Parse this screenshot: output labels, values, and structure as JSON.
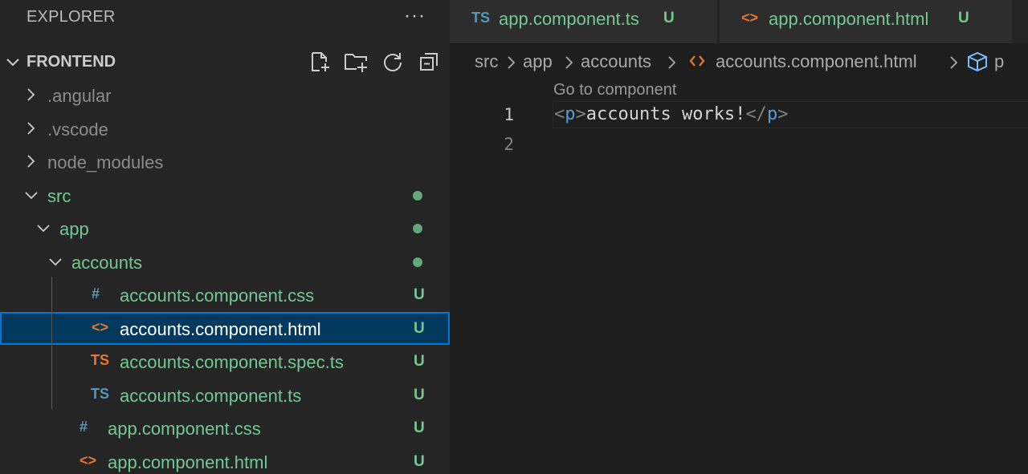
{
  "explorer": {
    "title": "EXPLORER",
    "more_label": "···",
    "section_title": "FRONTEND",
    "actions": [
      "new-file",
      "new-folder",
      "refresh",
      "collapse-all"
    ]
  },
  "tree": [
    {
      "label": ".angular",
      "type": "folder",
      "state": "collapsed",
      "depth": 0,
      "color": "dim"
    },
    {
      "label": ".vscode",
      "type": "folder",
      "state": "collapsed",
      "depth": 0,
      "color": "dim"
    },
    {
      "label": "node_modules",
      "type": "folder",
      "state": "collapsed",
      "depth": 0,
      "color": "dim"
    },
    {
      "label": "src",
      "type": "folder",
      "state": "expanded",
      "depth": 0,
      "color": "green",
      "decoration": "dot"
    },
    {
      "label": "app",
      "type": "folder",
      "state": "expanded",
      "depth": 1,
      "color": "green",
      "decoration": "dot"
    },
    {
      "label": "accounts",
      "type": "folder",
      "state": "expanded",
      "depth": 2,
      "color": "green",
      "decoration": "dot"
    },
    {
      "label": "accounts.component.css",
      "type": "file",
      "icon": "#",
      "icon_name": "css-icon",
      "icon_color": "#519aba",
      "depth": 3,
      "color": "green",
      "badge": "U"
    },
    {
      "label": "accounts.component.html",
      "type": "file",
      "icon": "<>",
      "icon_name": "html-icon",
      "icon_color": "#e37933",
      "depth": 3,
      "color": "white",
      "badge": "U",
      "selected": true
    },
    {
      "label": "accounts.component.spec.ts",
      "type": "file",
      "icon": "TS",
      "icon_name": "ts-spec-icon",
      "icon_color": "#e37933",
      "depth": 3,
      "color": "green",
      "badge": "U"
    },
    {
      "label": "accounts.component.ts",
      "type": "file",
      "icon": "TS",
      "icon_name": "ts-icon",
      "icon_color": "#519aba",
      "depth": 3,
      "color": "green",
      "badge": "U"
    },
    {
      "label": "app.component.css",
      "type": "file",
      "icon": "#",
      "icon_name": "css-icon",
      "icon_color": "#519aba",
      "depth": 2,
      "color": "green",
      "badge": "U"
    },
    {
      "label": "app.component.html",
      "type": "file",
      "icon": "<>",
      "icon_name": "html-icon",
      "icon_color": "#e37933",
      "depth": 2,
      "color": "green",
      "badge": "U"
    }
  ],
  "tabs": [
    {
      "label": "app.component.ts",
      "icon": "TS",
      "icon_color": "#519aba",
      "badge": "U"
    },
    {
      "label": "app.component.html",
      "icon": "<>",
      "icon_color": "#e37933",
      "badge": "U"
    }
  ],
  "breadcrumb": {
    "src": "src",
    "app": "app",
    "accounts": "accounts",
    "file": "accounts.component.html",
    "symbol": "p"
  },
  "editor": {
    "codelens": "Go to component",
    "line_numbers": [
      "1",
      "2"
    ],
    "tokens": {
      "open_lt": "<",
      "open_tag": "p",
      "open_gt": ">",
      "text": "accounts works!",
      "close_lt": "</",
      "close_tag": "p",
      "close_gt": ">"
    }
  },
  "colors": {
    "untracked_green": "#73c991",
    "selection_bg": "#04395e",
    "focus_border": "#0078d4",
    "ts_blue": "#519aba",
    "html_orange": "#e37933"
  }
}
